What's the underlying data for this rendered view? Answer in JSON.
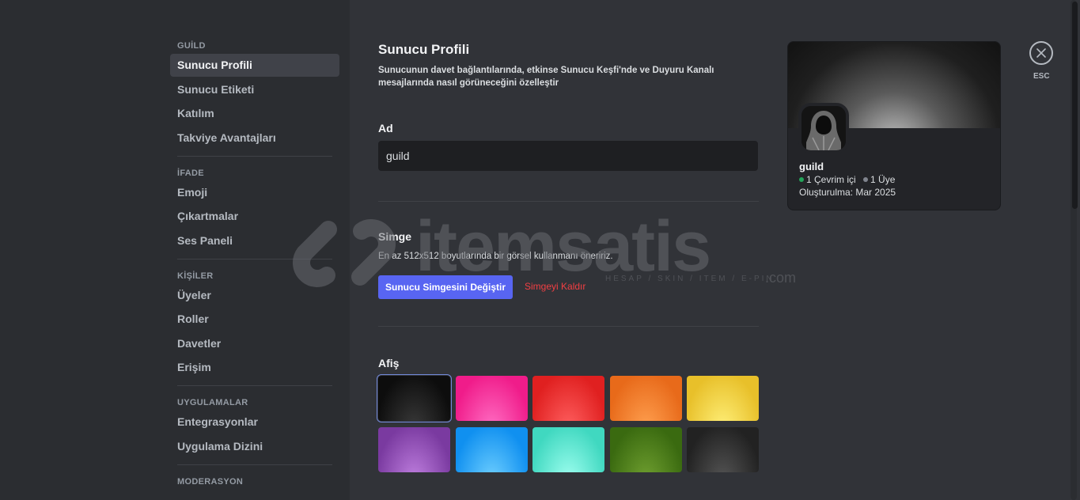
{
  "sidebar": {
    "sections": [
      {
        "heading": "GUİLD",
        "items": [
          "Sunucu Profili",
          "Sunucu Etiketi",
          "Katılım",
          "Takviye Avantajları"
        ]
      },
      {
        "heading": "İFADE",
        "items": [
          "Emoji",
          "Çıkartmalar",
          "Ses Paneli"
        ]
      },
      {
        "heading": "KİŞİLER",
        "items": [
          "Üyeler",
          "Roller",
          "Davetler",
          "Erişim"
        ]
      },
      {
        "heading": "UYGULAMALAR",
        "items": [
          "Entegrasyonlar",
          "Uygulama Dizini"
        ]
      },
      {
        "heading": "MODERASYON",
        "items": []
      }
    ],
    "active_item": "Sunucu Profili"
  },
  "main": {
    "title": "Sunucu Profili",
    "description": "Sunucunun davet bağlantılarında, etkinse Sunucu Keşfi'nde ve Duyuru Kanalı mesajlarında nasıl görüneceğini özelleştir",
    "name_label": "Ad",
    "name_value": "guild",
    "icon_label": "Simge",
    "icon_hint": "En az 512x512 boyutlarında bir görsel kullanmanı öneririz.",
    "change_icon_button": "Sunucu Simgesini Değiştir",
    "remove_icon_link": "Simgeyi Kaldır",
    "banner_label": "Afiş",
    "banner_swatches": [
      {
        "name": "black",
        "colors": [
          "#0d0d0d",
          "#3a3a3a"
        ],
        "selected": true
      },
      {
        "name": "pink",
        "colors": [
          "#f01c8a",
          "#ff6fc4"
        ],
        "selected": false
      },
      {
        "name": "red",
        "colors": [
          "#e02020",
          "#ff6060"
        ],
        "selected": false
      },
      {
        "name": "orange",
        "colors": [
          "#e86a1a",
          "#ffa050"
        ],
        "selected": false
      },
      {
        "name": "yellow",
        "colors": [
          "#e8c02a",
          "#fff07a"
        ],
        "selected": false
      },
      {
        "name": "purple",
        "colors": [
          "#7a3aa0",
          "#c080e0"
        ],
        "selected": false
      },
      {
        "name": "blue",
        "colors": [
          "#1090f0",
          "#70d0ff"
        ],
        "selected": false
      },
      {
        "name": "teal",
        "colors": [
          "#40d8c0",
          "#a0fff0"
        ],
        "selected": false
      },
      {
        "name": "green",
        "colors": [
          "#3a6a10",
          "#70a030"
        ],
        "selected": false
      },
      {
        "name": "gray",
        "colors": [
          "#222222",
          "#555555"
        ],
        "selected": false
      }
    ]
  },
  "preview_card": {
    "server_name": "guild",
    "online_text": "1 Çevrim içi",
    "members_text": "1 Üye",
    "created_text": "Oluşturulma: Mar 2025",
    "online_color": "#23a55a",
    "members_color": "#80848e"
  },
  "close": {
    "label": "ESC"
  },
  "watermark": {
    "text": "itemsatis",
    "sub": "HESAP / SKIN / ITEM / E-PIN",
    "domain": ".com"
  }
}
